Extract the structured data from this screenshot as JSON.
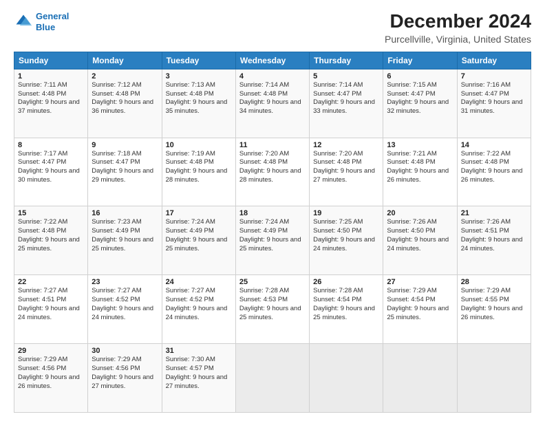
{
  "header": {
    "logo_line1": "General",
    "logo_line2": "Blue",
    "title": "December 2024",
    "subtitle": "Purcellville, Virginia, United States"
  },
  "days_of_week": [
    "Sunday",
    "Monday",
    "Tuesday",
    "Wednesday",
    "Thursday",
    "Friday",
    "Saturday"
  ],
  "weeks": [
    [
      {
        "day": 1,
        "sunrise": "7:11 AM",
        "sunset": "4:48 PM",
        "daylight": "9 hours and 37 minutes."
      },
      {
        "day": 2,
        "sunrise": "7:12 AM",
        "sunset": "4:48 PM",
        "daylight": "9 hours and 36 minutes."
      },
      {
        "day": 3,
        "sunrise": "7:13 AM",
        "sunset": "4:48 PM",
        "daylight": "9 hours and 35 minutes."
      },
      {
        "day": 4,
        "sunrise": "7:14 AM",
        "sunset": "4:48 PM",
        "daylight": "9 hours and 34 minutes."
      },
      {
        "day": 5,
        "sunrise": "7:14 AM",
        "sunset": "4:47 PM",
        "daylight": "9 hours and 33 minutes."
      },
      {
        "day": 6,
        "sunrise": "7:15 AM",
        "sunset": "4:47 PM",
        "daylight": "9 hours and 32 minutes."
      },
      {
        "day": 7,
        "sunrise": "7:16 AM",
        "sunset": "4:47 PM",
        "daylight": "9 hours and 31 minutes."
      }
    ],
    [
      {
        "day": 8,
        "sunrise": "7:17 AM",
        "sunset": "4:47 PM",
        "daylight": "9 hours and 30 minutes."
      },
      {
        "day": 9,
        "sunrise": "7:18 AM",
        "sunset": "4:47 PM",
        "daylight": "9 hours and 29 minutes."
      },
      {
        "day": 10,
        "sunrise": "7:19 AM",
        "sunset": "4:48 PM",
        "daylight": "9 hours and 28 minutes."
      },
      {
        "day": 11,
        "sunrise": "7:20 AM",
        "sunset": "4:48 PM",
        "daylight": "9 hours and 28 minutes."
      },
      {
        "day": 12,
        "sunrise": "7:20 AM",
        "sunset": "4:48 PM",
        "daylight": "9 hours and 27 minutes."
      },
      {
        "day": 13,
        "sunrise": "7:21 AM",
        "sunset": "4:48 PM",
        "daylight": "9 hours and 26 minutes."
      },
      {
        "day": 14,
        "sunrise": "7:22 AM",
        "sunset": "4:48 PM",
        "daylight": "9 hours and 26 minutes."
      }
    ],
    [
      {
        "day": 15,
        "sunrise": "7:22 AM",
        "sunset": "4:48 PM",
        "daylight": "9 hours and 25 minutes."
      },
      {
        "day": 16,
        "sunrise": "7:23 AM",
        "sunset": "4:49 PM",
        "daylight": "9 hours and 25 minutes."
      },
      {
        "day": 17,
        "sunrise": "7:24 AM",
        "sunset": "4:49 PM",
        "daylight": "9 hours and 25 minutes."
      },
      {
        "day": 18,
        "sunrise": "7:24 AM",
        "sunset": "4:49 PM",
        "daylight": "9 hours and 25 minutes."
      },
      {
        "day": 19,
        "sunrise": "7:25 AM",
        "sunset": "4:50 PM",
        "daylight": "9 hours and 24 minutes."
      },
      {
        "day": 20,
        "sunrise": "7:26 AM",
        "sunset": "4:50 PM",
        "daylight": "9 hours and 24 minutes."
      },
      {
        "day": 21,
        "sunrise": "7:26 AM",
        "sunset": "4:51 PM",
        "daylight": "9 hours and 24 minutes."
      }
    ],
    [
      {
        "day": 22,
        "sunrise": "7:27 AM",
        "sunset": "4:51 PM",
        "daylight": "9 hours and 24 minutes."
      },
      {
        "day": 23,
        "sunrise": "7:27 AM",
        "sunset": "4:52 PM",
        "daylight": "9 hours and 24 minutes."
      },
      {
        "day": 24,
        "sunrise": "7:27 AM",
        "sunset": "4:52 PM",
        "daylight": "9 hours and 24 minutes."
      },
      {
        "day": 25,
        "sunrise": "7:28 AM",
        "sunset": "4:53 PM",
        "daylight": "9 hours and 25 minutes."
      },
      {
        "day": 26,
        "sunrise": "7:28 AM",
        "sunset": "4:54 PM",
        "daylight": "9 hours and 25 minutes."
      },
      {
        "day": 27,
        "sunrise": "7:29 AM",
        "sunset": "4:54 PM",
        "daylight": "9 hours and 25 minutes."
      },
      {
        "day": 28,
        "sunrise": "7:29 AM",
        "sunset": "4:55 PM",
        "daylight": "9 hours and 26 minutes."
      }
    ],
    [
      {
        "day": 29,
        "sunrise": "7:29 AM",
        "sunset": "4:56 PM",
        "daylight": "9 hours and 26 minutes."
      },
      {
        "day": 30,
        "sunrise": "7:29 AM",
        "sunset": "4:56 PM",
        "daylight": "9 hours and 27 minutes."
      },
      {
        "day": 31,
        "sunrise": "7:30 AM",
        "sunset": "4:57 PM",
        "daylight": "9 hours and 27 minutes."
      },
      null,
      null,
      null,
      null
    ]
  ]
}
